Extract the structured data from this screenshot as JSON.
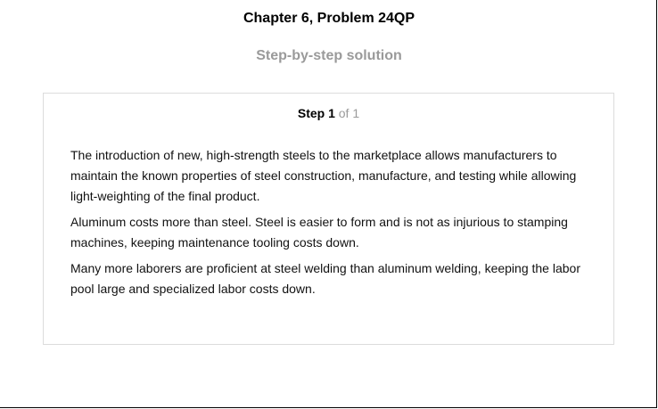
{
  "header": {
    "title": "Chapter 6, Problem 24QP",
    "subtitle": "Step-by-step solution"
  },
  "step": {
    "label": "Step 1",
    "of_label": "of 1"
  },
  "solution": {
    "paragraphs": [
      "The introduction of new, high-strength steels to the marketplace allows manufacturers to maintain the known properties of steel construction, manufacture, and testing while allowing light-weighting of the final product.",
      "Aluminum costs more than steel. Steel is easier to form and is not as injurious to stamping machines, keeping maintenance tooling costs down.",
      "Many more laborers are proficient at steel welding than aluminum welding, keeping the labor pool large and specialized labor costs down."
    ]
  }
}
